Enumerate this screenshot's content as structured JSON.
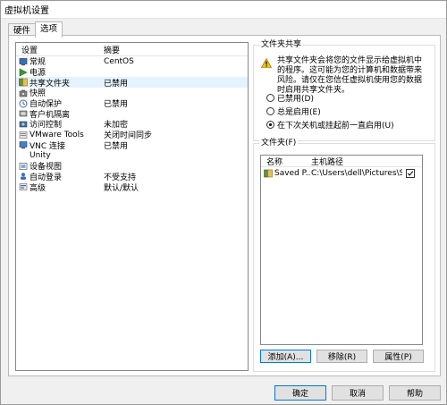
{
  "window": {
    "title": "虚拟机设置"
  },
  "tabs": [
    {
      "label": "硬件"
    },
    {
      "label": "选项"
    }
  ],
  "device_list": {
    "headers": {
      "setting": "设置",
      "summary": "摘要"
    },
    "items": [
      {
        "name": "常规",
        "summary": "CentOS",
        "icon": "general-icon"
      },
      {
        "name": "电源",
        "summary": "",
        "icon": "power-icon"
      },
      {
        "name": "共享文件夹",
        "summary": "已禁用",
        "icon": "shared-folder-icon"
      },
      {
        "name": "快照",
        "summary": "",
        "icon": "snapshot-icon"
      },
      {
        "name": "自动保护",
        "summary": "已禁用",
        "icon": "autoprotect-icon"
      },
      {
        "name": "客户机隔离",
        "summary": "",
        "icon": "isolation-icon"
      },
      {
        "name": "访问控制",
        "summary": "未加密",
        "icon": "access-control-icon"
      },
      {
        "name": "VMware Tools",
        "summary": "关闭时间同步",
        "icon": "vmware-tools-icon"
      },
      {
        "name": "VNC 连接",
        "summary": "已禁用",
        "icon": "vnc-icon"
      },
      {
        "name": "Unity",
        "summary": "",
        "icon": "unity-icon"
      },
      {
        "name": "设备视图",
        "summary": "",
        "icon": "device-view-icon"
      },
      {
        "name": "自动登录",
        "summary": "不受支持",
        "icon": "autologin-icon"
      },
      {
        "name": "高级",
        "summary": "默认/默认",
        "icon": "advanced-icon"
      }
    ]
  },
  "folder_sharing": {
    "title": "文件夹共享",
    "warning": "共享文件夹会将您的文件显示给虚拟机中的程序。这可能为您的计算机和数据带来风险。请仅在您信任虚拟机使用您的数据时启用共享文件夹。",
    "options": [
      {
        "label": "已禁用(D)",
        "selected": false
      },
      {
        "label": "总是启用(E)",
        "selected": false
      },
      {
        "label": "在下次关机或挂起前一直启用(U)",
        "selected": true
      }
    ]
  },
  "folders": {
    "title": "文件夹(F)",
    "headers": {
      "name": "名称",
      "host_path": "主机路径"
    },
    "rows": [
      {
        "name": "Saved P...",
        "path": "C:\\Users\\dell\\Pictures\\S...",
        "checked": true
      }
    ],
    "buttons": {
      "add": "添加(A)...",
      "remove": "移除(R)",
      "properties": "属性(P)"
    }
  },
  "footer": {
    "ok": "确定",
    "cancel": "取消",
    "help": "帮助"
  }
}
